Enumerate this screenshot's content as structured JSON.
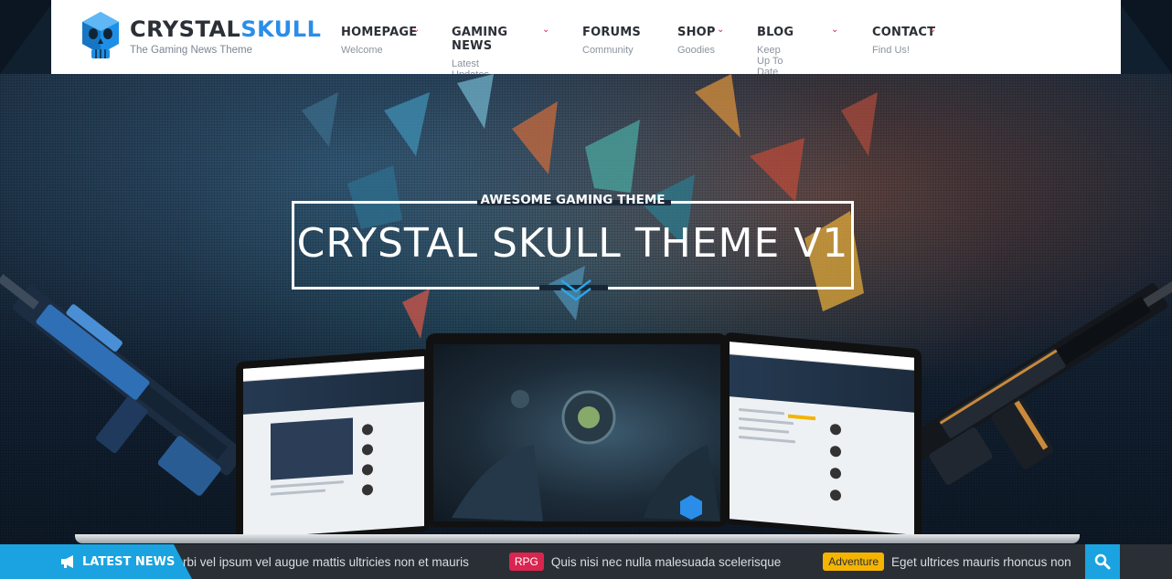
{
  "logo": {
    "title_part1": "CRYSTAL",
    "title_part2": "SKULL",
    "tagline": "The Gaming News Theme"
  },
  "nav": [
    {
      "label": "HOMEPAGE",
      "sub": "Welcome",
      "has_dropdown": true
    },
    {
      "label": "GAMING NEWS",
      "sub": "Latest Updates",
      "has_dropdown": true
    },
    {
      "label": "FORUMS",
      "sub": "Community",
      "has_dropdown": false
    },
    {
      "label": "SHOP",
      "sub": "Goodies",
      "has_dropdown": true
    },
    {
      "label": "BLOG",
      "sub": "Keep Up To Date",
      "has_dropdown": true
    },
    {
      "label": "CONTACT",
      "sub": "Find Us!",
      "has_dropdown": true
    }
  ],
  "hero": {
    "kicker": "AWESOME GAMING THEME",
    "title": "CRYSTAL SKULL THEME V1"
  },
  "ticker": {
    "label": "LATEST NEWS",
    "item1_text": "rbi vel ipsum vel augue mattis ultricies non et mauris",
    "item2_badge": "RPG",
    "item2_text": "Quis nisi nec nulla malesuada scelerisque",
    "item3_badge": "Adventure",
    "item3_text": "Eget ultrices mauris rhoncus non"
  },
  "colors": {
    "accent_blue": "#1aa3e0",
    "logo_blue": "#2a8ee8",
    "caret_red": "#d9254f",
    "badge_rpg": "#d9254f",
    "badge_adventure": "#f4b400"
  },
  "icons": {
    "logo": "skull-icon",
    "dropdown": "chevron-down-icon",
    "hero_arrow": "double-chevron-down-icon",
    "ticker": "megaphone-icon",
    "search": "search-icon"
  }
}
